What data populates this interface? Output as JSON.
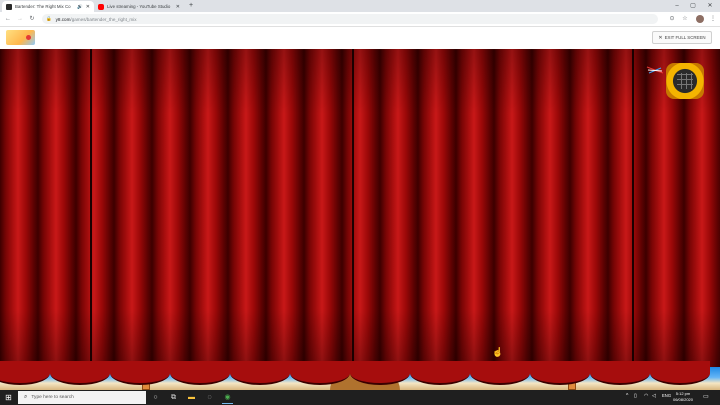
{
  "browser": {
    "tabs": [
      {
        "title": "Bartender: The Right Mix Co",
        "active": true,
        "favicon": "y8-icon",
        "audio": true
      },
      {
        "title": "Live streaming - YouTube Studio",
        "active": false,
        "favicon": "youtube-icon"
      }
    ],
    "new_tab_symbol": "+",
    "window_controls": {
      "minimize": "–",
      "maximize": "▢",
      "close": "✕"
    },
    "nav": {
      "back": "←",
      "forward": "→",
      "reload": "↻"
    },
    "url": {
      "host": "y8.com",
      "path": "/games/bartender_the_right_mix"
    }
  },
  "site": {
    "exit_fullscreen_label": "EXIT FULL SCREEN",
    "exit_fullscreen_icon": "✕"
  },
  "game": {
    "title_hint": "Bartender: The Right Mix",
    "curtain_color": "#b01010"
  },
  "taskbar": {
    "search_placeholder": "Type here to search",
    "tray_lang": "ENG",
    "time": "5:12 pm",
    "date": "06/08/2020"
  },
  "colors": {
    "accent": "#1a73e8",
    "taskbar": "#1f1f1f",
    "curtain": "#b01010"
  }
}
